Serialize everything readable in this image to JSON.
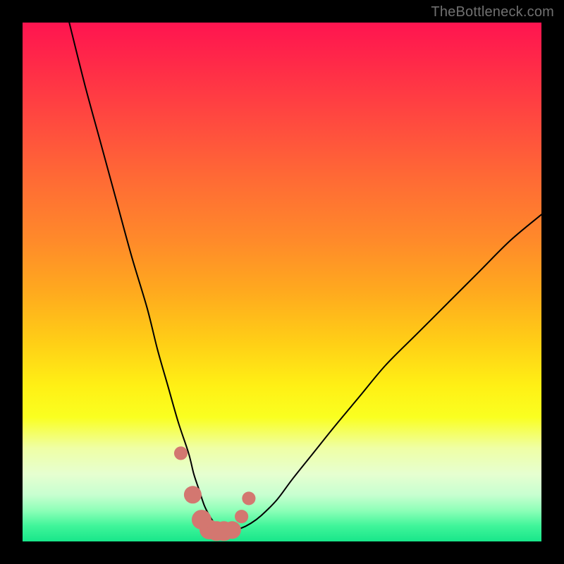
{
  "watermark": {
    "text": "TheBottleneck.com"
  },
  "colors": {
    "frame": "#000000",
    "curve": "#000000",
    "marker": "#d37770",
    "gradient_stops": [
      "#ff1450",
      "#ff2a48",
      "#ff4740",
      "#ff6a35",
      "#ff8a2a",
      "#ffaa1e",
      "#ffd016",
      "#fff015",
      "#faff20",
      "#efffa5",
      "#e6ffd0",
      "#c8ffd0",
      "#8effb8",
      "#40f59a",
      "#18e68a"
    ]
  },
  "chart_data": {
    "type": "line",
    "title": "",
    "xlabel": "",
    "ylabel": "",
    "xlim": [
      0,
      100
    ],
    "ylim": [
      0,
      100
    ],
    "series": [
      {
        "name": "bottleneck-curve",
        "x": [
          9,
          12,
          15,
          18,
          21,
          24,
          26,
          28,
          30,
          32,
          33,
          34,
          35,
          36,
          37,
          38,
          39,
          40,
          42,
          44,
          46,
          49,
          52,
          56,
          60,
          65,
          70,
          76,
          82,
          88,
          94,
          100
        ],
        "y": [
          100,
          88,
          77,
          66,
          55,
          45,
          37,
          30,
          23,
          17,
          13,
          10,
          7,
          5,
          3.5,
          2.5,
          2,
          2,
          2.5,
          3.5,
          5,
          8,
          12,
          17,
          22,
          28,
          34,
          40,
          46,
          52,
          58,
          63
        ]
      }
    ],
    "markers": {
      "name": "highlight-points",
      "x": [
        30.5,
        32.8,
        34.5,
        36,
        37.4,
        38.8,
        40.4,
        42.2,
        43.6
      ],
      "y": [
        17,
        9,
        4.2,
        2.3,
        2,
        2,
        2.2,
        4.8,
        8.3
      ],
      "r": [
        1.3,
        1.7,
        1.9,
        1.9,
        1.9,
        1.9,
        1.7,
        1.3,
        1.3
      ]
    }
  }
}
